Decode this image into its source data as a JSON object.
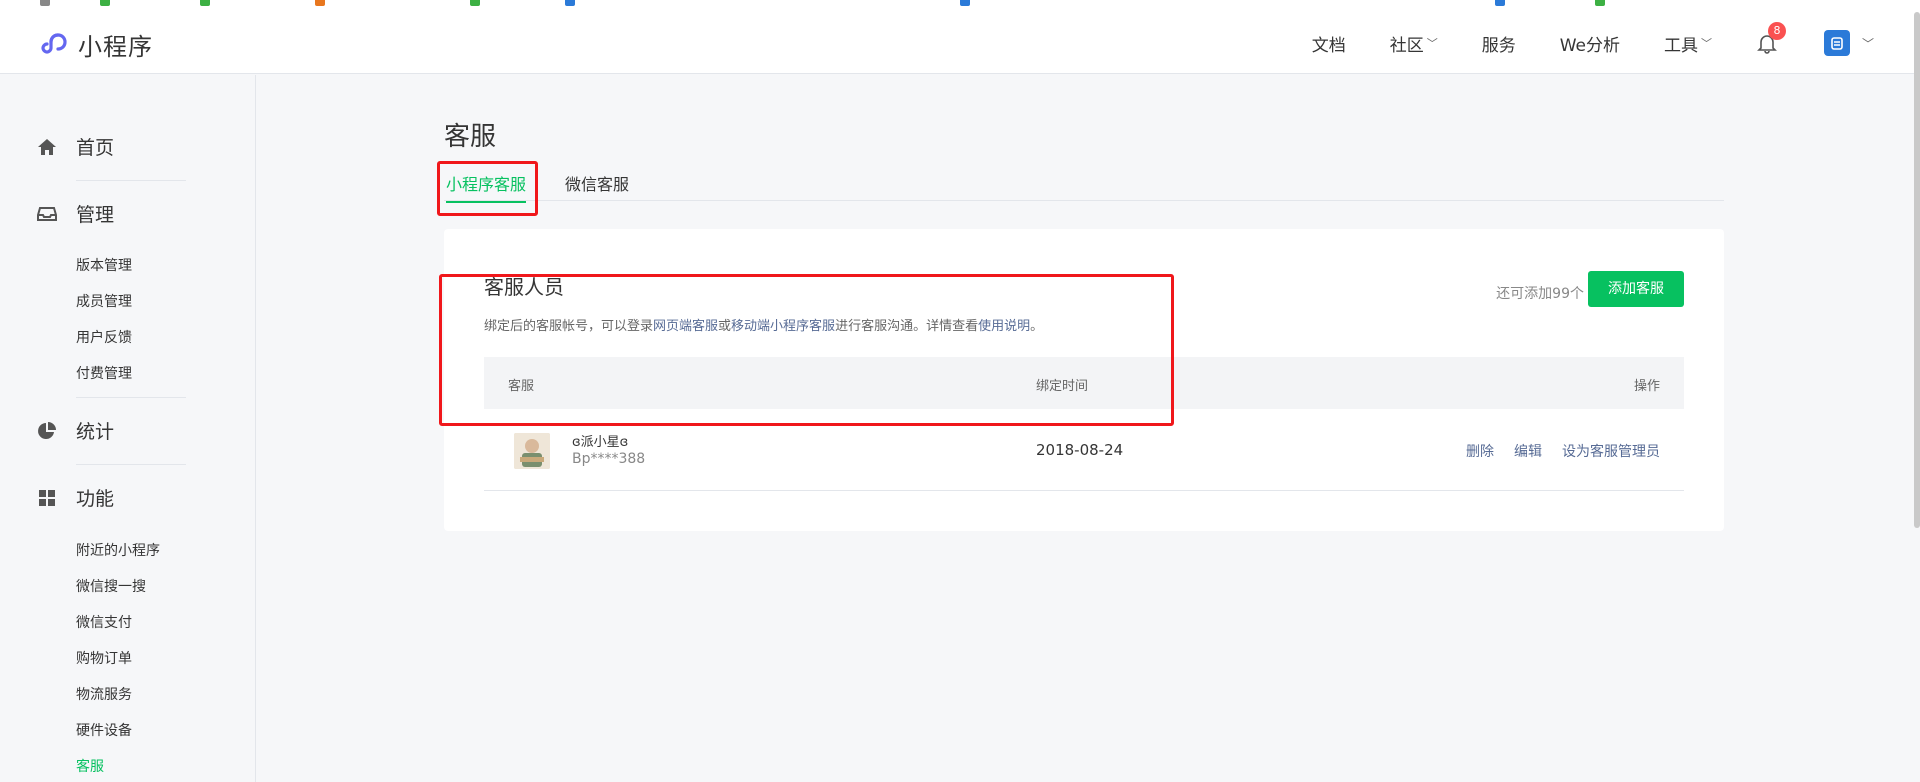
{
  "colors": {
    "accent": "#07c160",
    "link": "#576b95",
    "annotation": "#f0171b",
    "badge": "#fa5151"
  },
  "topbar": {
    "brand": "小程序",
    "nav": [
      {
        "label": "文档",
        "has_dropdown": false
      },
      {
        "label": "社区",
        "has_dropdown": true
      },
      {
        "label": "服务",
        "has_dropdown": false
      },
      {
        "label": "We分析",
        "has_dropdown": false
      },
      {
        "label": "工具",
        "has_dropdown": true
      }
    ],
    "notification_count": "8",
    "icons": {
      "logo": "miniprogram-logo-icon",
      "bell": "bell-icon",
      "avatar": "account-avatar-icon"
    }
  },
  "sidebar": {
    "groups": [
      {
        "label": "首页",
        "icon": "home-icon",
        "items": []
      },
      {
        "label": "管理",
        "icon": "inbox-icon",
        "items": [
          "版本管理",
          "成员管理",
          "用户反馈",
          "付费管理"
        ]
      },
      {
        "label": "统计",
        "icon": "pie-chart-icon",
        "items": []
      },
      {
        "label": "功能",
        "icon": "grid-icon",
        "items": [
          "附近的小程序",
          "微信搜一搜",
          "微信支付",
          "购物订单",
          "物流服务",
          "硬件设备",
          "客服"
        ]
      }
    ],
    "active_item": "客服"
  },
  "page": {
    "title": "客服",
    "tabs": [
      {
        "label": "小程序客服",
        "active": true
      },
      {
        "label": "微信客服",
        "active": false
      }
    ]
  },
  "card": {
    "title": "客服人员",
    "desc_prefix": "绑定后的客服帐号，可以登录",
    "desc_link1": "网页端客服",
    "desc_or": "或",
    "desc_link2": "移动端小程序客服",
    "desc_mid": "进行客服沟通。详情查看",
    "desc_link3": "使用说明",
    "desc_end": "。",
    "quota": "还可添加99个",
    "add_button": "添加客服",
    "columns": [
      "客服",
      "绑定时间",
      "操作"
    ],
    "rows": [
      {
        "nickname": "ɞ派小星ɞ",
        "account": "Bp****388",
        "date": "2018-08-24",
        "actions": [
          "删除",
          "编辑",
          "设为客服管理员"
        ]
      }
    ]
  }
}
